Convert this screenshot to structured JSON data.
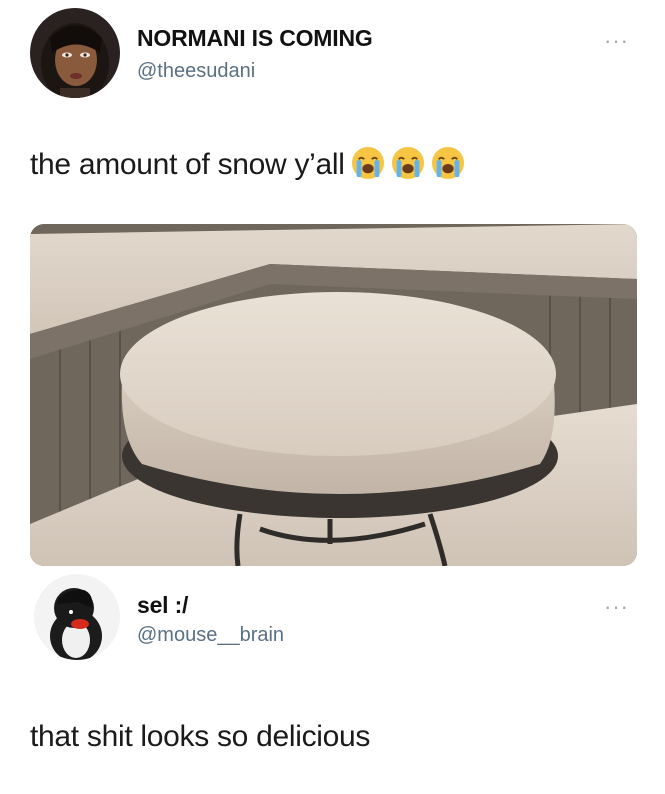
{
  "tweet_1": {
    "display_name": "NORMANI IS COMING",
    "handle": "@theesudani",
    "more_label": "···",
    "text": "the amount of snow y’all",
    "emojis": [
      "loudly-crying-face",
      "loudly-crying-face",
      "loudly-crying-face"
    ]
  },
  "tweet_2": {
    "display_name": "sel :/",
    "handle": "@mouse__brain",
    "more_label": "···",
    "text": "that shit looks so delicious"
  }
}
